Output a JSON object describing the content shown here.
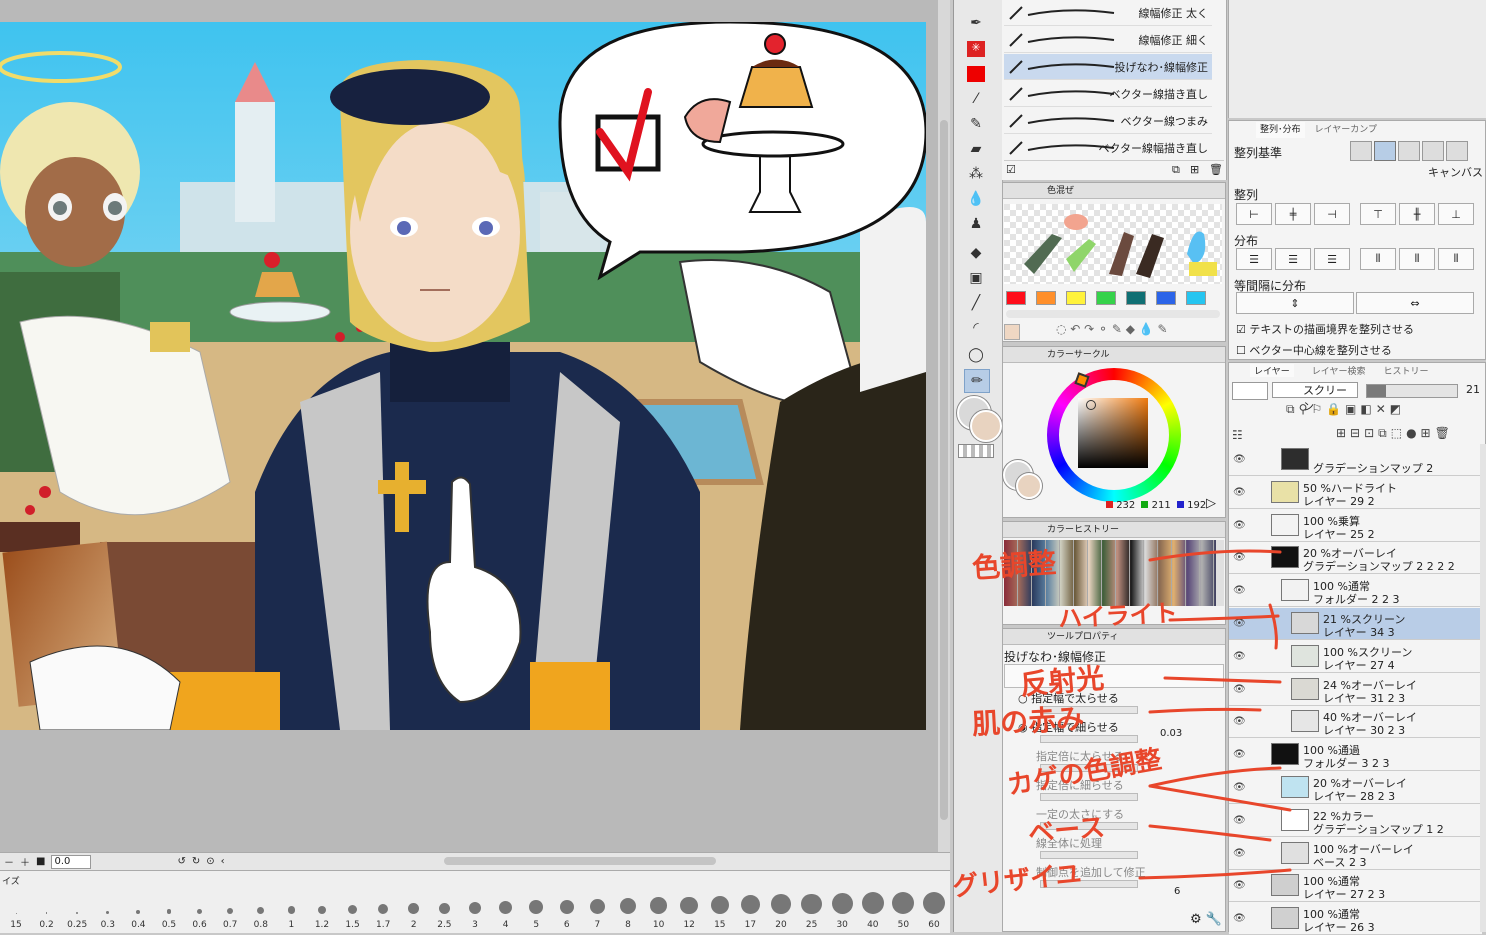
{
  "canvas": {
    "zoom_value": "0.0",
    "speech_bubble_check": "☑"
  },
  "brush_size_palette": {
    "title": "イズ",
    "sizes": [
      "15",
      "0.2",
      "0.25",
      "0.3",
      "0.4",
      "0.5",
      "0.6",
      "0.7",
      "0.8",
      "1",
      "1.2",
      "1.5",
      "1.7",
      "2",
      "2.5",
      "3",
      "4",
      "5",
      "6",
      "7",
      "8",
      "10",
      "12",
      "15",
      "17",
      "20",
      "25",
      "30",
      "40",
      "50",
      "60"
    ]
  },
  "subtool_list": {
    "items": [
      {
        "label": "線幅修正 太く",
        "selected": false
      },
      {
        "label": "線幅修正 細く",
        "selected": false
      },
      {
        "label": "投げなわ･線幅修正",
        "selected": true
      },
      {
        "label": "ベクター線描き直し",
        "selected": false
      },
      {
        "label": "ベクター線つまみ",
        "selected": false
      },
      {
        "label": "ベクター線幅描き直し",
        "selected": false
      }
    ]
  },
  "color_mix_panel": {
    "title": "色混ぜ",
    "colors": [
      "#ff0d1a",
      "#ff8f2a",
      "#fff23b",
      "#35d24a",
      "#0f6f73",
      "#2b64e8",
      "#25c5f0"
    ]
  },
  "color_circle_panel": {
    "title": "カラーサークル",
    "r": "232",
    "g": "211",
    "b": "192"
  },
  "color_history_panel": {
    "title": "カラーヒストリー"
  },
  "tool_property_panel": {
    "title": "ツールプロパティ",
    "tool_name": "投げなわ･線幅修正",
    "options": [
      "指定幅で太らせる",
      "指定幅で細らせる",
      "指定倍に太らせる",
      "指定倍に細らせる",
      "一定の太さにする",
      "線全体に処理",
      "制御点を追加して修正"
    ],
    "value_1": "0.03",
    "value_2": "6"
  },
  "align_panel": {
    "tab_1": "整列･分布",
    "tab_2": "レイヤーカンプ",
    "basis_label": "整列基準",
    "basis_value": "キャンバス",
    "align_label": "整列",
    "distribute_label": "分布",
    "equal_label": "等間隔に分布",
    "check_1": "テキストの描画境界を整列させる",
    "check_2": "ベクター中心線を整列させる"
  },
  "layer_panel": {
    "tab_1": "レイヤー",
    "tab_2": "レイヤー検索",
    "tab_3": "ヒストリー",
    "blend_mode": "スクリーン",
    "opacity": "21",
    "layers": [
      {
        "line1": "",
        "line2": "グラデーションマップ 2",
        "selected": false
      },
      {
        "line1": "50 %ハードライト",
        "line2": "レイヤー 29 2",
        "selected": false
      },
      {
        "line1": "100 %乗算",
        "line2": "レイヤー 25 2",
        "selected": false
      },
      {
        "line1": "20 %オーバーレイ",
        "line2": "グラデーションマップ 2 2 2 2",
        "selected": false
      },
      {
        "line1": "100 %通常",
        "line2": "フォルダー 2 2 3",
        "selected": false
      },
      {
        "line1": "21 %スクリーン",
        "line2": "レイヤー 34 3",
        "selected": true
      },
      {
        "line1": "100 %スクリーン",
        "line2": "レイヤー 27 4",
        "selected": false
      },
      {
        "line1": "24 %オーバーレイ",
        "line2": "レイヤー 31 2 3",
        "selected": false
      },
      {
        "line1": "40 %オーバーレイ",
        "line2": "レイヤー 30 2 3",
        "selected": false
      },
      {
        "line1": "100 %通過",
        "line2": "フォルダー 3 2 3",
        "selected": false
      },
      {
        "line1": "20 %オーバーレイ",
        "line2": "レイヤー 28 2 3",
        "selected": false
      },
      {
        "line1": "22 %カラー",
        "line2": "グラデーションマップ 1 2",
        "selected": false
      },
      {
        "line1": "100 %オーバーレイ",
        "line2": "ベース 2 3",
        "selected": false
      },
      {
        "line1": "100 %通常",
        "line2": "レイヤー 27 2 3",
        "selected": false
      },
      {
        "line1": "100 %通常",
        "line2": "レイヤー 26 3",
        "selected": false
      }
    ]
  },
  "annotations": {
    "color_tone": "色調整",
    "highlight": "ハイライト",
    "reflected_light": "反射光",
    "skin_redness": "肌の赤み",
    "shadow_tone": "カゲの色調整",
    "base": "ベース",
    "grisaille": "グリザイユ"
  },
  "accent_colors": {
    "selection": "#b9cde7",
    "annotation": "#e8462b"
  }
}
